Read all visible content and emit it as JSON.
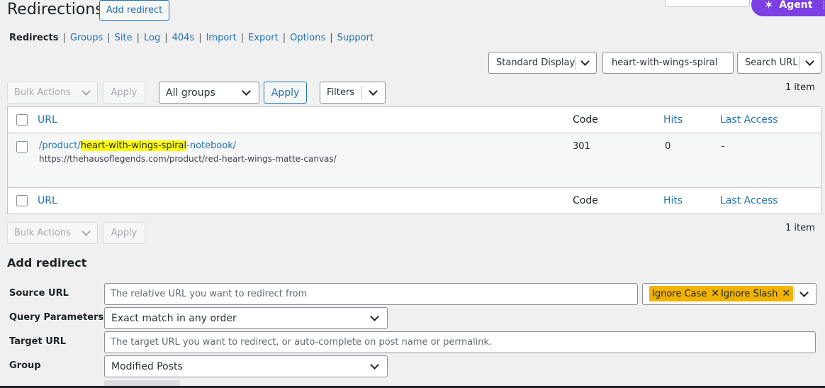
{
  "header": {
    "title": "Redirections",
    "add_redirect_button": "Add redirect",
    "agent_button": "Agent"
  },
  "subnav": {
    "items": [
      {
        "label": "Redirects",
        "current": true
      },
      {
        "label": "Groups"
      },
      {
        "label": "Site"
      },
      {
        "label": "Log"
      },
      {
        "label": "404s"
      },
      {
        "label": "Import"
      },
      {
        "label": "Export"
      },
      {
        "label": "Options"
      },
      {
        "label": "Support"
      }
    ],
    "separator": "|"
  },
  "search": {
    "display_select": "Standard Display",
    "query": "heart-with-wings-spiral",
    "search_select": "Search URL"
  },
  "toolbar_top": {
    "bulk_actions": "Bulk Actions",
    "apply": "Apply",
    "groups_select": "All groups",
    "groups_apply": "Apply",
    "filters": "Filters",
    "count": "1 item"
  },
  "table": {
    "columns": {
      "url": "URL",
      "code": "Code",
      "hits": "Hits",
      "last_access": "Last Access"
    },
    "rows": [
      {
        "source_prefix": "/product/",
        "source_highlight": "heart-with-wings-spiral",
        "source_suffix": "-notebook/",
        "target": "https://thehausoflegends.com/product/red-heart-wings-matte-canvas/",
        "code": "301",
        "hits": "0",
        "last_access": "-"
      }
    ]
  },
  "toolbar_bottom": {
    "bulk_actions": "Bulk Actions",
    "apply": "Apply",
    "count": "1 item"
  },
  "add_redirect": {
    "heading": "Add redirect",
    "source_label": "Source URL",
    "source_placeholder": "The relative URL you want to redirect from",
    "tags": [
      "Ignore Case",
      "Ignore Slash"
    ],
    "query_label": "Query Parameters",
    "query_value": "Exact match in any order",
    "target_label": "Target URL",
    "target_placeholder": "The target URL you want to redirect, or auto-complete on post name or permalink.",
    "group_label": "Group",
    "group_value": "Modified Posts"
  },
  "colors": {
    "link": "#2271b1",
    "agent": "#7b3fe4",
    "tag": "#f0b300",
    "highlight": "#ffff00"
  }
}
